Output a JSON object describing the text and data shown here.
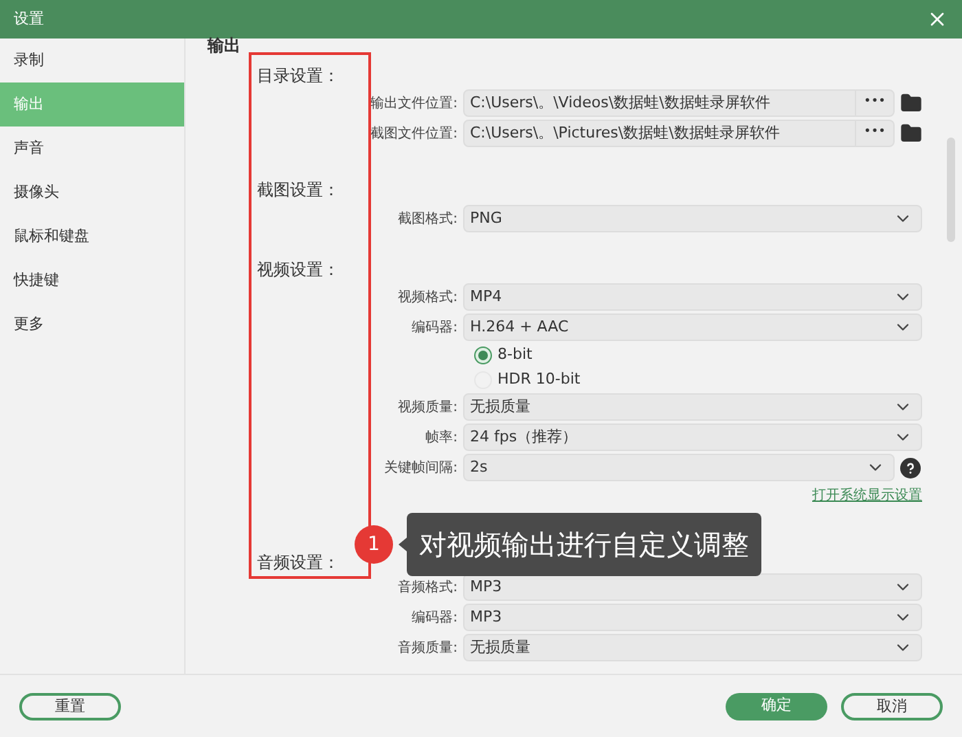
{
  "window": {
    "title": "设置"
  },
  "sidebar": {
    "items": [
      {
        "label": "录制",
        "selected": false
      },
      {
        "label": "输出",
        "selected": true
      },
      {
        "label": "声音",
        "selected": false
      },
      {
        "label": "摄像头",
        "selected": false
      },
      {
        "label": "鼠标和键盘",
        "selected": false
      },
      {
        "label": "快捷键",
        "selected": false
      },
      {
        "label": "更多",
        "selected": false
      }
    ]
  },
  "page_title": "输出",
  "sections": [
    {
      "title": "目录设置：",
      "rows": [
        {
          "kind": "path",
          "label": "输出文件位置:",
          "value": "C:\\Users\\。\\Videos\\数据蛙\\数据蛙录屏软件",
          "button": "•••"
        },
        {
          "kind": "path",
          "label": "截图文件位置:",
          "value": "C:\\Users\\。\\Pictures\\数据蛙\\数据蛙录屏软件",
          "button": "•••"
        }
      ]
    },
    {
      "title": "截图设置：",
      "rows": [
        {
          "kind": "select",
          "label": "截图格式:",
          "value": "PNG"
        }
      ]
    },
    {
      "title": "视频设置：",
      "rows": [
        {
          "kind": "select",
          "label": "视频格式:",
          "value": "MP4"
        },
        {
          "kind": "select",
          "label": "编码器:",
          "value": "H.264 + AAC"
        },
        {
          "kind": "radio",
          "label": "8-bit",
          "selected": true
        },
        {
          "kind": "radio",
          "label": "HDR 10-bit",
          "selected": false
        },
        {
          "kind": "select",
          "label": "视频质量:",
          "value": "无损质量"
        },
        {
          "kind": "select",
          "label": "帧率:",
          "value": "24 fps（推荐）"
        },
        {
          "kind": "help_select",
          "label": "关键帧间隔:",
          "value": "2s"
        },
        {
          "kind": "link",
          "label": "打开系统显示设置"
        }
      ]
    },
    {
      "title": "音频设置：",
      "rows": [
        {
          "kind": "select",
          "label": "音频格式:",
          "value": "MP3"
        },
        {
          "kind": "select",
          "label": "编码器:",
          "value": "MP3"
        },
        {
          "kind": "select",
          "label": "音频质量:",
          "value": "无损质量"
        }
      ]
    }
  ],
  "callout": {
    "number": "1",
    "text": "对视频输出进行自定义调整"
  },
  "footer": {
    "buttons": [
      {
        "label": "重置",
        "kind": "outline"
      },
      {
        "label": "确定",
        "kind": "primary"
      },
      {
        "label": "取消",
        "kind": "outline"
      }
    ]
  }
}
